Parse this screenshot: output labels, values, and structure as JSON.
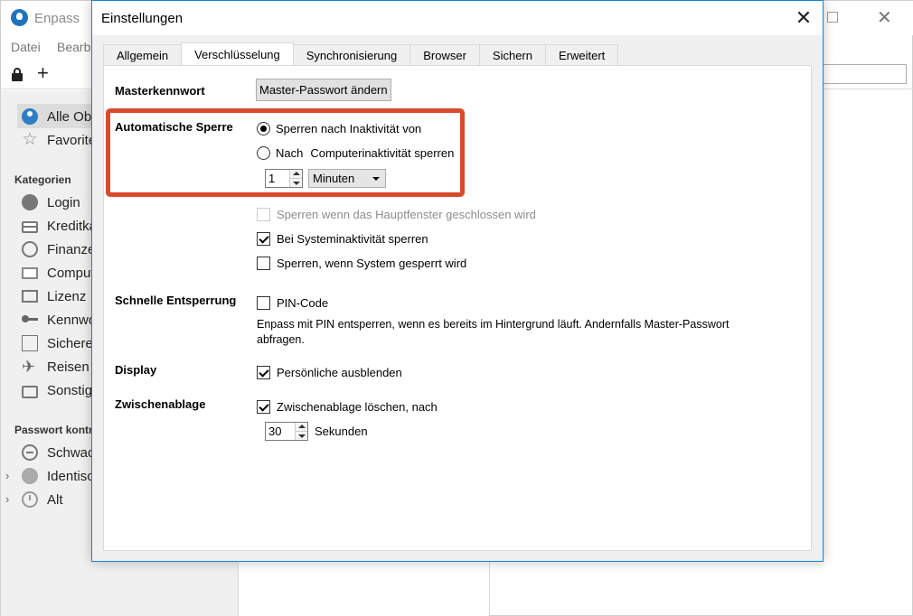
{
  "background_app": {
    "title": "Enpass",
    "menu": [
      "Datei",
      "Bearb"
    ],
    "sidebar": {
      "favorites": [
        {
          "label": "Alle Obj",
          "icon": "key-circle-icon"
        },
        {
          "label": "Favorite",
          "icon": "star-icon"
        }
      ],
      "categories_heading": "Kategorien",
      "categories": [
        {
          "label": "Login",
          "icon": "globe-icon"
        },
        {
          "label": "Kreditka",
          "icon": "credit-card-icon"
        },
        {
          "label": "Finanze",
          "icon": "finance-icon"
        },
        {
          "label": "Comput",
          "icon": "computer-icon"
        },
        {
          "label": "Lizenz",
          "icon": "license-icon"
        },
        {
          "label": "Kennwo",
          "icon": "key-icon"
        },
        {
          "label": "Sichere",
          "icon": "secure-note-icon"
        },
        {
          "label": "Reisen",
          "icon": "plane-icon"
        },
        {
          "label": "Sonstig",
          "icon": "briefcase-icon"
        }
      ],
      "audit_heading": "Passwort kontr",
      "audit": [
        {
          "label": "Schwac",
          "icon": "minus-circle-icon"
        },
        {
          "label": "Identisc",
          "icon": "identical-icon"
        },
        {
          "label": "Alt",
          "icon": "clock-icon"
        }
      ]
    }
  },
  "dialog": {
    "title": "Einstellungen",
    "tabs": [
      "Allgemein",
      "Verschlüsselung",
      "Synchronisierung",
      "Browser",
      "Sichern",
      "Erweitert"
    ],
    "active_tab": "Verschlüsselung",
    "master": {
      "label": "Masterkennwort",
      "button": "Master-Passwort ändern"
    },
    "autolock": {
      "label": "Automatische Sperre",
      "option1": "Sperren nach Inaktivität von",
      "option2_a": "Nach",
      "option2_b": "Computerinaktivität sperren",
      "duration_value": "1",
      "duration_unit": "Minuten",
      "close_main_window": "Sperren wenn das Hauptfenster geschlossen wird",
      "system_idle": "Bei Systeminaktivität sperren",
      "system_locked": "Sperren, wenn System gesperrt wird"
    },
    "quick_unlock": {
      "label": "Schnelle Entsperrung",
      "pin": "PIN-Code",
      "description": "Enpass mit PIN entsperren, wenn es bereits im Hintergrund läuft. Andernfalls Master-Passwort abfragen."
    },
    "display": {
      "label": "Display",
      "hide_personal": "Persönliche ausblenden"
    },
    "clipboard": {
      "label": "Zwischenablage",
      "clear_after": "Zwischenablage löschen, nach",
      "seconds_value": "30",
      "seconds_unit": "Sekunden"
    }
  },
  "state": {
    "radio_option1": true,
    "radio_option2": false,
    "close_main_window": false,
    "close_main_window_disabled": true,
    "system_idle": true,
    "system_locked": false,
    "pin": false,
    "hide_personal": true,
    "clear_clipboard": true
  },
  "annotation_color": "#d94a2c",
  "accent_color": "#1883d7"
}
